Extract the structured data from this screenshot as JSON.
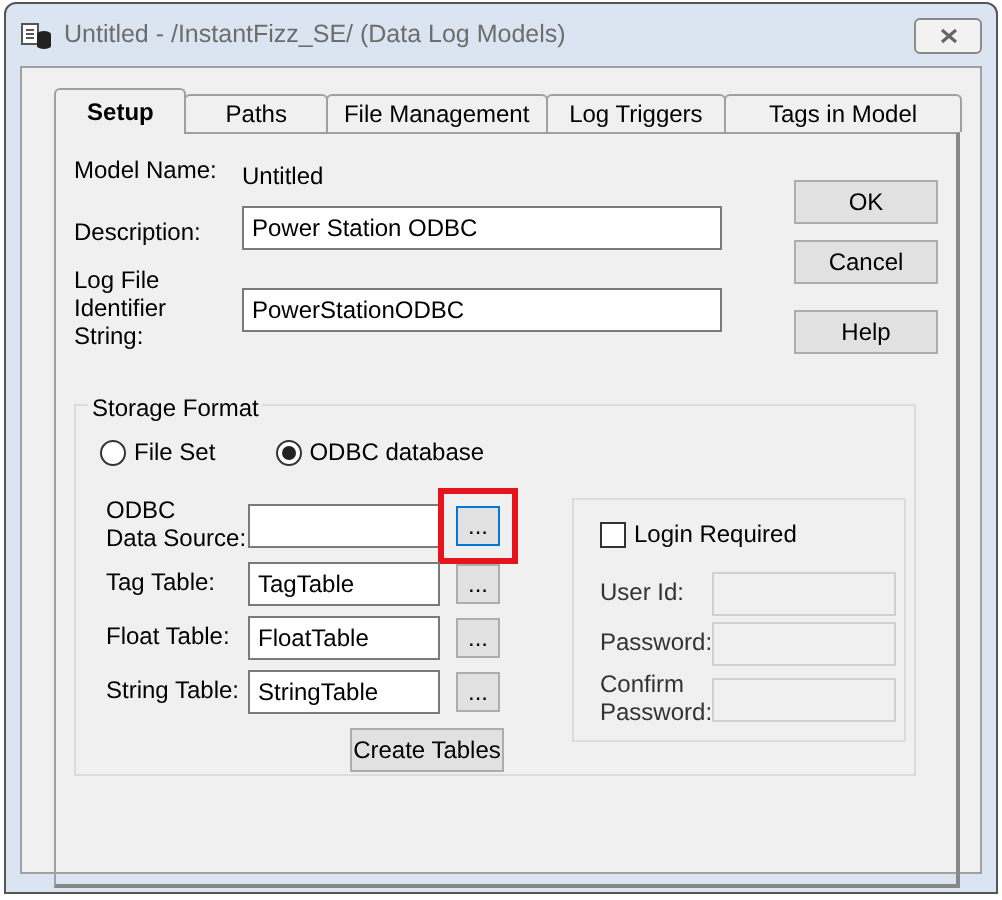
{
  "window": {
    "title": "Untitled - /InstantFizz_SE/ (Data Log Models)"
  },
  "tabs": [
    {
      "label": "Setup",
      "selected": true
    },
    {
      "label": "Paths",
      "selected": false
    },
    {
      "label": "File Management",
      "selected": false
    },
    {
      "label": "Log Triggers",
      "selected": false
    },
    {
      "label": "Tags in Model",
      "selected": false
    }
  ],
  "model_name": {
    "label": "Model Name:",
    "value": "Untitled"
  },
  "fields": [
    {
      "label": "Description:",
      "value": "Power Station ODBC"
    },
    {
      "label": "Log File\nIdentifier String:",
      "value": "PowerStationODBC"
    }
  ],
  "buttons": [
    "OK",
    "Cancel",
    "Help"
  ],
  "storage_format": {
    "title": "Storage Format",
    "options": [
      {
        "label": "File Set",
        "selected": false
      },
      {
        "label": "ODBC database",
        "selected": true
      }
    ],
    "tables": [
      {
        "label": "ODBC\nData Source:",
        "browse": "...",
        "highlighted": true
      },
      {
        "label": "Tag Table:",
        "value": "TagTable",
        "browse": "...",
        "highlighted": false
      },
      {
        "label": "Float Table:",
        "value": "FloatTable",
        "browse": "...",
        "highlighted": false
      },
      {
        "label": "String Table:",
        "value": "StringTable",
        "browse": "...",
        "highlighted": false
      }
    ],
    "create_button": "Create Tables",
    "login": {
      "label": "Login Required",
      "checked": false,
      "fields": [
        {
          "label": "User Id:",
          "disabled": true
        },
        {
          "label": "Password:",
          "disabled": true
        },
        {
          "label": "Confirm\nPassword:",
          "disabled": true
        }
      ]
    }
  }
}
